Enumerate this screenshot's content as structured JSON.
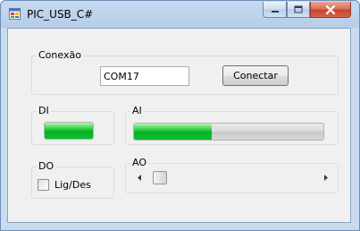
{
  "window": {
    "title": "PIC_USB_C#",
    "icon": "app-window-icon",
    "controls": {
      "minimize": "minimize-icon",
      "maximize": "maximize-icon",
      "close": "close-icon"
    }
  },
  "conexao": {
    "label": "Conexão",
    "port_value": "COM17",
    "connect_label": "Conectar"
  },
  "di": {
    "label": "DI",
    "level": 1.0
  },
  "ai": {
    "label": "AI",
    "level": 0.41
  },
  "do": {
    "label": "DO",
    "checkbox_label": "Lig/Des",
    "checked": false
  },
  "ao": {
    "label": "AO",
    "scroll_level": 0.0
  },
  "colors": {
    "progress_green": "#06b025",
    "close_red": "#c8442a",
    "title_bar": "#b6cde8"
  }
}
